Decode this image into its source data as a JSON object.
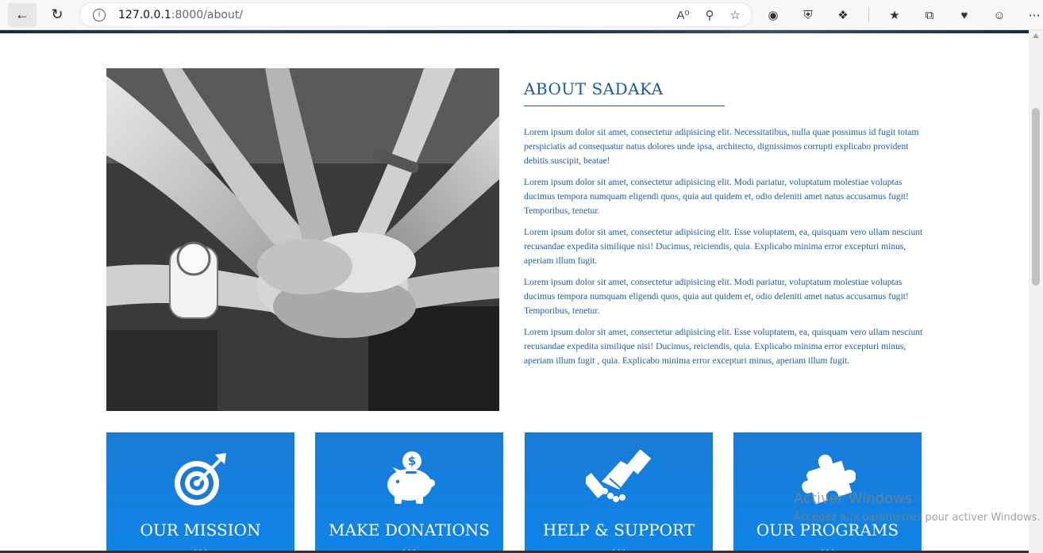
{
  "browser": {
    "url_host": "127.0.0.1",
    "url_rest": ":8000/about/",
    "icons": [
      "back-icon",
      "reload-icon",
      "info-icon",
      "read-aloud-icon",
      "zoom-icon",
      "favorite-star-icon",
      "extension-icon",
      "shield-icon",
      "puzzle-icon",
      "favorites-icon",
      "collections-icon",
      "performance-icon",
      "profile-icon",
      "more-icon"
    ]
  },
  "about": {
    "title": "ABOUT SADAKA",
    "paragraphs": [
      "Lorem ipsum dolor sit amet, consectetur adipisicing elit. Necessitatibus, nulla quae possimus id fugit totam perspiciatis ad consequatur natus dolores unde ipsa, architecto, dignissimos corrupti explicabo provident debitis suscipit, beatae!",
      "Lorem ipsum dolor sit amet, consectetur adipisicing elit. Modi pariatur, voluptatum molestiae voluptas ducimus tempora numquam eligendi quos, quia aut quidem et, odio deleniti amet natus accusamus fugit! Temporibus, tenetur.",
      "Lorem ipsum dolor sit amet, consectetur adipisicing elit. Esse voluptatem, ea, quisquam vero ullam nesciunt recusandae expedita similique nisi! Ducimus, reiciendis, quia. Explicabo minima error excepturi minus, aperiam illum fugit.",
      "Lorem ipsum dolor sit amet, consectetur adipisicing elit. Modi pariatur, voluptatum molestiae voluptas ducimus tempora numquam eligendi quos, quia aut quidem et, odio deleniti amet natus accusamus fugit! Temporibus, tenetur.",
      "Lorem ipsum dolor sit amet, consectetur adipisicing elit. Esse voluptatem, ea, quisquam vero ullam nesciunt recusandae expedita similique nisi! Ducimus, reiciendis, quia. Explicabo minima error excepturi minus, aperiam illum fugit , quia. Explicabo minima error excepturi minus, aperiam illum fugit."
    ]
  },
  "cards": [
    {
      "title": "OUR MISSION",
      "icon": "target-icon"
    },
    {
      "title": "MAKE DONATIONS",
      "icon": "piggy-bank-icon"
    },
    {
      "title": "HELP & SUPPORT",
      "icon": "handshake-icon"
    },
    {
      "title": "OUR PROGRAMS",
      "icon": "puzzle-piece-icon"
    }
  ],
  "watermark": {
    "line1": "Activer Windows",
    "line2": "Accédez aux paramètres pour activer Windows."
  },
  "colors": {
    "accent": "#1a5aa0",
    "card_blue": "#1380e0"
  }
}
